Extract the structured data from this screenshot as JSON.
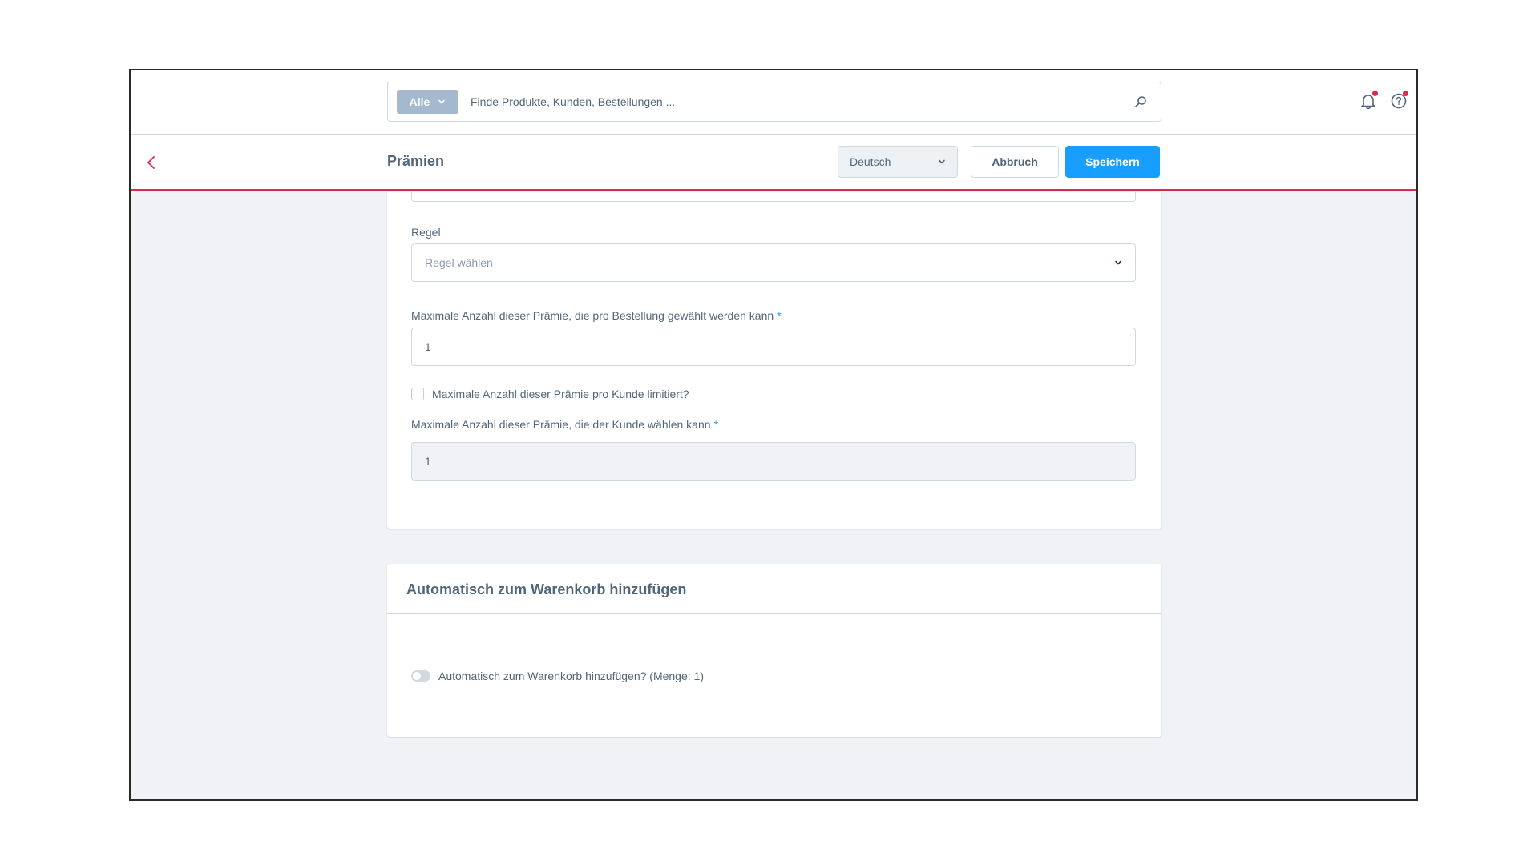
{
  "topbar": {
    "search": {
      "type_label": "Alle",
      "placeholder": "Finde Produkte, Kunden, Bestellungen ..."
    }
  },
  "smartbar": {
    "title": "Prämien",
    "language": "Deutsch",
    "cancel_label": "Abbruch",
    "save_label": "Speichern"
  },
  "form": {
    "rule": {
      "label": "Regel",
      "placeholder": "Regel wählen"
    },
    "max_per_order": {
      "label": "Maximale Anzahl dieser Prämie, die pro Bestellung gewählt werden kann",
      "required_mark": "*",
      "value": "1"
    },
    "limit_per_customer": {
      "label": "Maximale Anzahl dieser Prämie pro Kunde limitiert?",
      "checked": false
    },
    "max_per_customer": {
      "label": "Maximale Anzahl dieser Prämie, die der Kunde wählen kann",
      "required_mark": "*",
      "value": "1"
    }
  },
  "auto_add_card": {
    "title": "Automatisch zum Warenkorb hinzufügen",
    "toggle_label": "Automatisch zum Warenkorb hinzufügen? (Menge: 1)",
    "enabled": false
  },
  "colors": {
    "accent": "#189eff",
    "alert": "#de294c",
    "text": "#52667a"
  }
}
